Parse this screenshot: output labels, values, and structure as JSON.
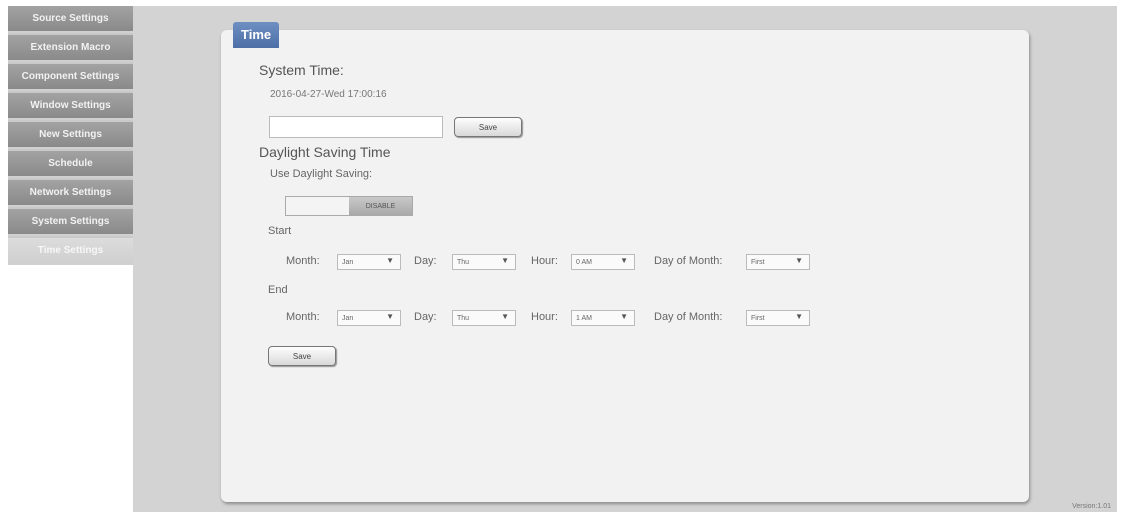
{
  "sidebar": {
    "items": [
      {
        "label": "Source Settings"
      },
      {
        "label": "Extension Macro"
      },
      {
        "label": "Component Settings"
      },
      {
        "label": "Window Settings"
      },
      {
        "label": "New Settings"
      },
      {
        "label": "Schedule"
      },
      {
        "label": "Network Settings"
      },
      {
        "label": "System Settings"
      },
      {
        "label": "Time Settings"
      }
    ],
    "active_index": 8
  },
  "panel": {
    "tab_title": "Time",
    "system_time": {
      "heading": "System Time:",
      "current_value": "2016-04-27-Wed 17:00:16",
      "input_value": "",
      "save_label": "Save"
    },
    "dst": {
      "heading": "Daylight Saving Time",
      "use_label": "Use Daylight Saving:",
      "toggle_value": "DISABLE",
      "start_label": "Start",
      "end_label": "End",
      "month_label": "Month:",
      "day_label": "Day:",
      "hour_label": "Hour:",
      "dom_label": "Day of Month:",
      "start": {
        "month": "Jan",
        "day": "Thu",
        "hour": "0 AM",
        "dom": "First"
      },
      "end": {
        "month": "Jan",
        "day": "Thu",
        "hour": "1 AM",
        "dom": "First"
      },
      "save_label": "Save"
    }
  },
  "footer": {
    "version": "Version:1.01"
  },
  "colors": {
    "accent": "#5a7db5",
    "sidebar": "#999999"
  }
}
